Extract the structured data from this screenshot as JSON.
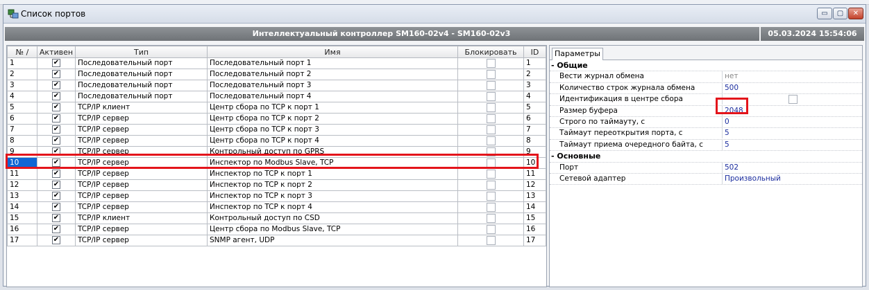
{
  "window": {
    "title": "Список портов",
    "buttons": {
      "minimize": "▭",
      "maximize": "▢",
      "close": "✕"
    }
  },
  "banner": {
    "title": "Интеллектуальный контроллер SM160-02v4 - SM160-02v3",
    "datetime": "05.03.2024 15:54:06"
  },
  "table": {
    "columns": [
      "№ /",
      "Активен",
      "Тип",
      "Имя",
      "Блокировать",
      "ID"
    ],
    "rows": [
      {
        "num": "1",
        "active": true,
        "type": "Последовательный порт",
        "name": "Последовательный порт 1",
        "block": false,
        "id": "1"
      },
      {
        "num": "2",
        "active": true,
        "type": "Последовательный порт",
        "name": "Последовательный порт 2",
        "block": false,
        "id": "2"
      },
      {
        "num": "3",
        "active": true,
        "type": "Последовательный порт",
        "name": "Последовательный порт 3",
        "block": false,
        "id": "3"
      },
      {
        "num": "4",
        "active": true,
        "type": "Последовательный порт",
        "name": "Последовательный порт 4",
        "block": false,
        "id": "4"
      },
      {
        "num": "5",
        "active": true,
        "type": "TCP/IP клиент",
        "name": "Центр сбора по TCP к порт 1",
        "block": false,
        "id": "5"
      },
      {
        "num": "6",
        "active": true,
        "type": "TCP/IP сервер",
        "name": "Центр сбора по TCP к порт 2",
        "block": false,
        "id": "6"
      },
      {
        "num": "7",
        "active": true,
        "type": "TCP/IP сервер",
        "name": "Центр сбора по TCP к порт 3",
        "block": false,
        "id": "7"
      },
      {
        "num": "8",
        "active": true,
        "type": "TCP/IP сервер",
        "name": "Центр сбора по TCP к порт 4",
        "block": false,
        "id": "8"
      },
      {
        "num": "9",
        "active": true,
        "type": "TCP/IP сервер",
        "name": "Контрольный доступ по GPRS",
        "block": false,
        "id": "9"
      },
      {
        "num": "10",
        "active": true,
        "type": "TCP/IP сервер",
        "name": "Инспектор по Modbus Slave, TCP",
        "block": false,
        "id": "10",
        "selected": true
      },
      {
        "num": "11",
        "active": true,
        "type": "TCP/IP сервер",
        "name": "Инспектор по TCP к порт 1",
        "block": false,
        "id": "11"
      },
      {
        "num": "12",
        "active": true,
        "type": "TCP/IP сервер",
        "name": "Инспектор по TCP к порт 2",
        "block": false,
        "id": "12"
      },
      {
        "num": "13",
        "active": true,
        "type": "TCP/IP сервер",
        "name": "Инспектор по TCP к порт 3",
        "block": false,
        "id": "13"
      },
      {
        "num": "14",
        "active": true,
        "type": "TCP/IP сервер",
        "name": "Инспектор по TCP к порт 4",
        "block": false,
        "id": "14"
      },
      {
        "num": "15",
        "active": true,
        "type": "TCP/IP клиент",
        "name": "Контрольный доступ по CSD",
        "block": false,
        "id": "15"
      },
      {
        "num": "16",
        "active": true,
        "type": "TCP/IP сервер",
        "name": "Центр сбора по Modbus Slave, TCP",
        "block": false,
        "id": "16"
      },
      {
        "num": "17",
        "active": true,
        "type": "TCP/IP сервер",
        "name": "SNMP агент, UDP",
        "block": false,
        "id": "17"
      }
    ]
  },
  "params": {
    "tab": "Параметры",
    "sections": [
      {
        "title": "- Общие",
        "rows": [
          {
            "name": "Вести журнал обмена",
            "value": "нет",
            "gray": true
          },
          {
            "name": "Количество строк журнала обмена",
            "value": "500"
          },
          {
            "name": "Идентификация в центре сбора",
            "value": "",
            "checkbox": true
          },
          {
            "name": "Размер буфера",
            "value": "2048"
          },
          {
            "name": "Строго по таймауту, с",
            "value": "0"
          },
          {
            "name": "Таймаут переоткрытия порта, с",
            "value": "5"
          },
          {
            "name": "Таймаут приема очередного байта, с",
            "value": "5"
          }
        ]
      },
      {
        "title": "- Основные",
        "rows": [
          {
            "name": "Порт",
            "value": "502"
          },
          {
            "name": "Сетевой адаптер",
            "value": "Произвольный"
          }
        ]
      }
    ]
  },
  "colors": {
    "selection": "#0f66d4",
    "highlight": "#e3141b",
    "banner": "#7f8387",
    "value_text": "#1a2c9e"
  },
  "icons": {
    "window": "ports-list-icon",
    "checked": "✔"
  }
}
